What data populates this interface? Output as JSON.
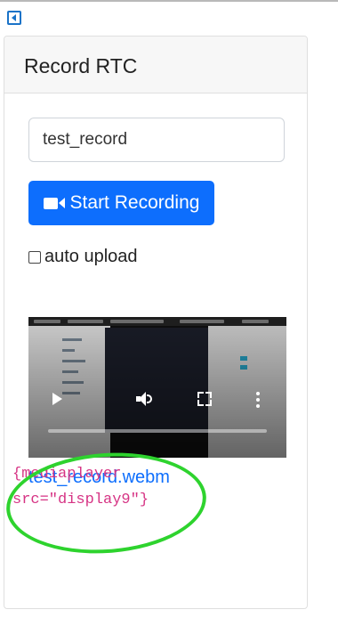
{
  "panel": {
    "title": "Record RTC",
    "name_input": {
      "value": "test_record",
      "placeholder": ""
    },
    "record_button_label": "Start Recording",
    "auto_upload": {
      "label": "auto upload",
      "checked": false
    }
  },
  "video_player": {
    "progress": 0
  },
  "recording": {
    "file_link": "test_record.webm",
    "shortcode_line1": "{mediaplayer",
    "shortcode_line2": "src=\"display9\"}"
  },
  "colors": {
    "primary": "#0d6efd",
    "code": "#d63384",
    "annotation": "#2ed32e"
  },
  "icons": [
    "collapse-arrow-icon",
    "video-camera-icon",
    "play-icon",
    "volume-icon",
    "fullscreen-icon",
    "more-options-icon"
  ]
}
